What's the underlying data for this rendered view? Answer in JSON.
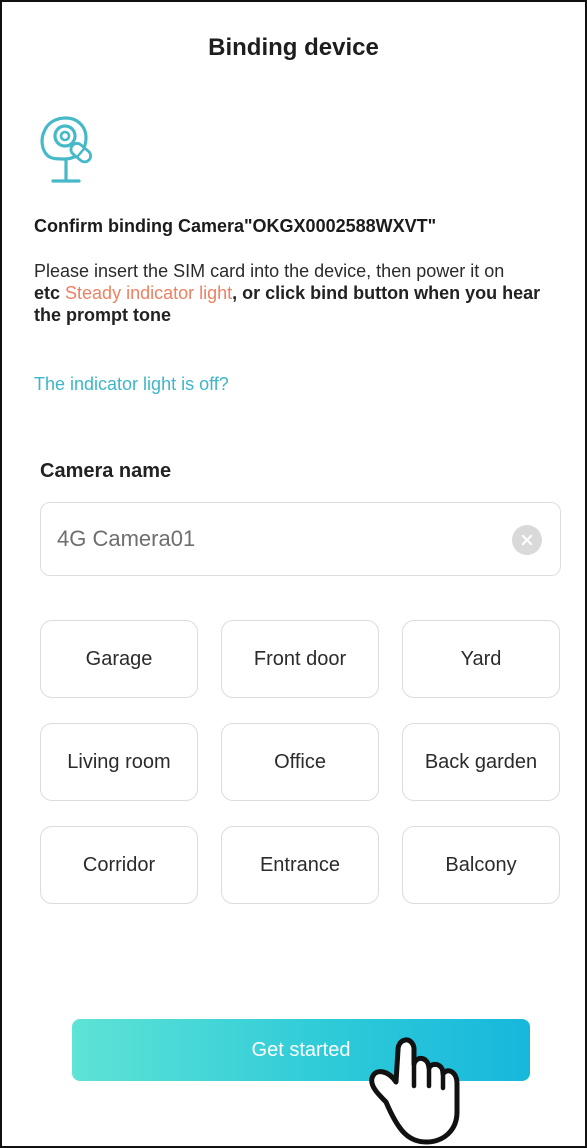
{
  "header": {
    "title": "Binding device"
  },
  "device": {
    "icon": "camera-icon",
    "confirm_text": "Confirm binding  Camera\"OKGX0002588WXVT\""
  },
  "instructions": {
    "line1": "Please insert the SIM card into the device, then power it on",
    "prefix": "etc ",
    "highlight": "Steady indicator light",
    "suffix": ", or click bind button when you hear the prompt tone",
    "highlight_color": "#ef8062"
  },
  "help_link": {
    "label": "The indicator light is off?",
    "color": "#3cb6c8"
  },
  "camera_name": {
    "label": "Camera name",
    "value": "4G Camera01",
    "clear_icon": "clear-icon"
  },
  "location_chips": [
    {
      "label": "Garage"
    },
    {
      "label": "Front door"
    },
    {
      "label": "Yard"
    },
    {
      "label": "Living room"
    },
    {
      "label": "Office"
    },
    {
      "label": "Back garden"
    },
    {
      "label": "Corridor"
    },
    {
      "label": "Entrance"
    },
    {
      "label": "Balcony"
    }
  ],
  "primary_button": {
    "label": "Get started",
    "gradient": [
      "#5ee3d6",
      "#17b7dc"
    ]
  },
  "overlay": {
    "icon": "pointing-hand-icon"
  }
}
